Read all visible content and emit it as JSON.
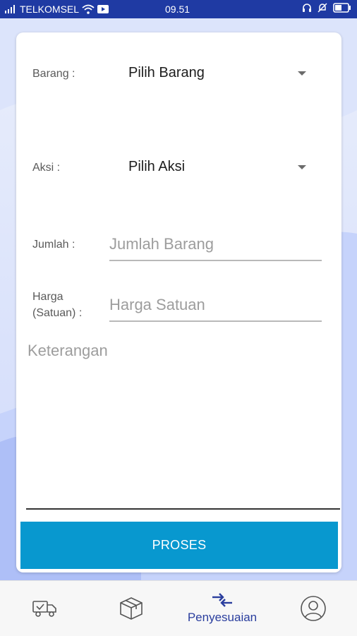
{
  "status_bar": {
    "carrier": "TELKOMSEL",
    "time": "09.51"
  },
  "form": {
    "barang_label": "Barang :",
    "barang_value": "Pilih Barang",
    "aksi_label": "Aksi :",
    "aksi_value": "Pilih Aksi",
    "jumlah_label": "Jumlah :",
    "jumlah_placeholder": "Jumlah Barang",
    "harga_label_line1": "Harga",
    "harga_label_line2": "(Satuan) :",
    "harga_placeholder": "Harga Satuan",
    "keterangan_placeholder": "Keterangan",
    "submit_label": "PROSES"
  },
  "bottom_nav": {
    "items": [
      {
        "icon": "truck-check-icon",
        "label": ""
      },
      {
        "icon": "package-box-icon",
        "label": ""
      },
      {
        "icon": "swap-arrows-icon",
        "label": "Penyesuaian",
        "active": true
      },
      {
        "icon": "user-profile-icon",
        "label": ""
      }
    ]
  },
  "colors": {
    "status_bar": "#1f3aa3",
    "button": "#0898cf",
    "active_nav": "#2a3e9e"
  }
}
